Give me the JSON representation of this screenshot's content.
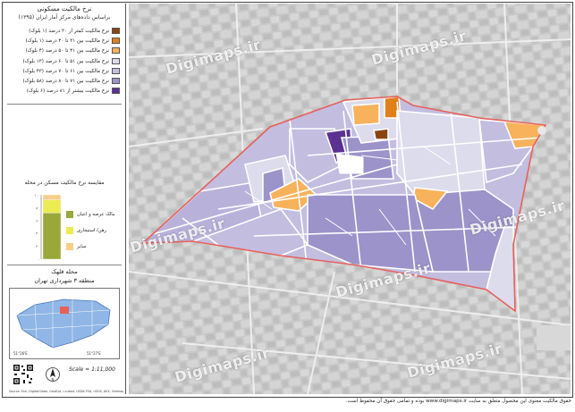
{
  "map_title": "نرخ مالکیت مسکونی",
  "map_subtitle": "براساس داده‌های مرکز آمار ایران (۱۳۹۵)",
  "legend_items": [
    {
      "label": "نرخ مالکیت کمتر از ۳۰ درصد (۱ بلوک)",
      "color": "#8b4513"
    },
    {
      "label": "نرخ مالکیت بین ۳۱ تا ۴۰ درصد (۱ بلوک)",
      "color": "#e0801a"
    },
    {
      "label": "نرخ مالکیت بین ۴۱ تا ۵۰ درصد (۴ بلوک)",
      "color": "#f8b25c"
    },
    {
      "label": "نرخ مالکیت بین ۵۱ تا ۶۰ درصد (۱۳ بلوک)",
      "color": "#dcdcec"
    },
    {
      "label": "نرخ مالکیت بین ۶۱ تا ۷۰ درصد (۴۳ بلوک)",
      "color": "#c3bde0"
    },
    {
      "label": "نرخ مالکیت بین ۷۱ تا ۸۰ درصد (۵۸ بلوک)",
      "color": "#9b93c9"
    },
    {
      "label": "نرخ مالکیت بیشتر از ۸۱ درصد (۶ بلوک)",
      "color": "#5b3192"
    }
  ],
  "chart_title": "مقایسه نرخ مالکیت مسکن در محله",
  "chart_data": {
    "type": "bar",
    "categories": [
      "محله"
    ],
    "series": [
      {
        "name": "مالک عرصه و اعیان",
        "color": "#9aa83a",
        "values": [
          72
        ]
      },
      {
        "name": "رهن/ استیجاری",
        "color": "#ecec52",
        "values": [
          20
        ]
      },
      {
        "name": "سایر",
        "color": "#f5cf8a",
        "values": [
          8
        ]
      }
    ],
    "ylim": [
      0,
      100
    ],
    "yticks": [
      "۰",
      "۲۰",
      "۴۰",
      "۶۰",
      "۸۰",
      "۱۰۰"
    ]
  },
  "location_neighborhood": "محله قلهک",
  "location_district": "منطقه ۳ شهرداری تهران",
  "scale_text": "Scale = 1:11,000",
  "north_label": "N",
  "credit_text": "Source: Esri, DigitalGlobe, GeoEye, i-cubed, USDA FSA, USGS, AEX, Getmapping, Aerogrid, IGN, IGP, swisstopo",
  "footer_text": "حقوق مالکیت معنوی این محصول متعلق به سایت www.digimaps.ir بوده و تمامی حقوق آن محفوظ است.",
  "watermark": "Digimaps.ir",
  "grid_labels": [
    "51°26'E",
    "51°27'E",
    "35°46'N"
  ],
  "colors": {
    "boundary": "#e8605a",
    "map_bg": "#cfcfcf"
  }
}
